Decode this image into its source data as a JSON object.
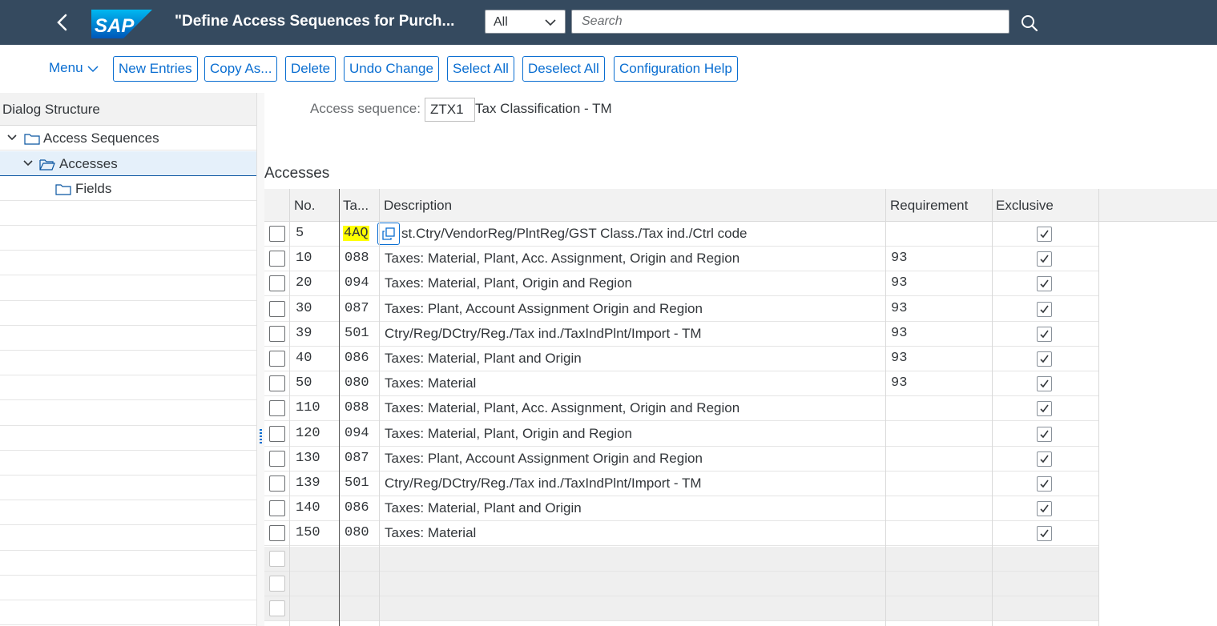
{
  "header": {
    "title": "\"Define Access Sequences for Purch...",
    "logo_text": "SAP",
    "scope_value": "All",
    "search_placeholder": "Search"
  },
  "toolbar": {
    "menu_label": "Menu",
    "buttons": [
      "New Entries",
      "Copy As...",
      "Delete",
      "Undo Change",
      "Select All",
      "Deselect All",
      "Configuration Help"
    ]
  },
  "dialog_structure": {
    "title": "Dialog Structure",
    "items": [
      {
        "label": "Access Sequences"
      },
      {
        "label": "Accesses",
        "selected": true
      },
      {
        "label": "Fields"
      }
    ]
  },
  "access_sequence": {
    "label": "Access sequence:",
    "value": "ZTX1",
    "description": "Tax Classification - TM"
  },
  "accesses": {
    "title": "Accesses",
    "columns": [
      "No.",
      "Ta...",
      "Description",
      "Requirement",
      "Exclusive"
    ],
    "rows": [
      {
        "no": "5",
        "table": "4AQ",
        "description": "st.Ctry/VendorReg/PlntReg/GST Class./Tax ind./Ctrl code",
        "requirement": "",
        "exclusive": true
      },
      {
        "no": "10",
        "table": "088",
        "description": "Taxes: Material, Plant, Acc. Assignment, Origin and Region",
        "requirement": "93",
        "exclusive": true
      },
      {
        "no": "20",
        "table": "094",
        "description": "Taxes: Material, Plant, Origin and Region",
        "requirement": "93",
        "exclusive": true
      },
      {
        "no": "30",
        "table": "087",
        "description": "Taxes: Plant, Account Assignment Origin and Region",
        "requirement": "93",
        "exclusive": true
      },
      {
        "no": "39",
        "table": "501",
        "description": "Ctry/Reg/DCtry/Reg./Tax ind./TaxIndPlnt/Import - TM",
        "requirement": "93",
        "exclusive": true
      },
      {
        "no": "40",
        "table": "086",
        "description": "Taxes: Material, Plant and Origin",
        "requirement": "93",
        "exclusive": true
      },
      {
        "no": "50",
        "table": "080",
        "description": "Taxes: Material",
        "requirement": "93",
        "exclusive": true
      },
      {
        "no": "110",
        "table": "088",
        "description": "Taxes: Material, Plant, Acc. Assignment, Origin and Region",
        "requirement": "",
        "exclusive": true
      },
      {
        "no": "120",
        "table": "094",
        "description": "Taxes: Material, Plant, Origin and Region",
        "requirement": "",
        "exclusive": true
      },
      {
        "no": "130",
        "table": "087",
        "description": "Taxes: Plant, Account Assignment Origin and Region",
        "requirement": "",
        "exclusive": true
      },
      {
        "no": "139",
        "table": "501",
        "description": "Ctry/Reg/DCtry/Reg./Tax ind./TaxIndPlnt/Import - TM",
        "requirement": "",
        "exclusive": true
      },
      {
        "no": "140",
        "table": "086",
        "description": "Taxes: Material, Plant and Origin",
        "requirement": "",
        "exclusive": true
      },
      {
        "no": "150",
        "table": "080",
        "description": "Taxes: Material",
        "requirement": "",
        "exclusive": true
      }
    ]
  },
  "colors": {
    "shell": "#354a5f",
    "accent": "#0a6ed1",
    "highlight": "#ffff00"
  },
  "icons": [
    "back-icon",
    "sap-logo",
    "chevron-down-icon",
    "search-icon",
    "folder-icon",
    "open-folder-icon",
    "value-help-icon",
    "checkmark-icon"
  ]
}
